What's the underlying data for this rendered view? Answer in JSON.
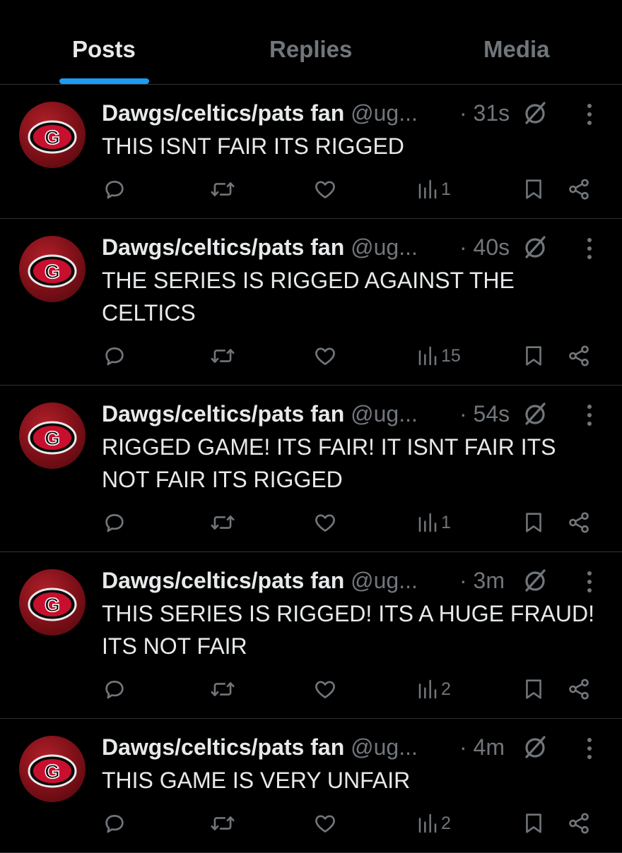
{
  "tabs": [
    {
      "label": "Posts",
      "active": true
    },
    {
      "label": "Replies",
      "active": false
    },
    {
      "label": "Media",
      "active": false
    }
  ],
  "accent_color": "#1d9bf0",
  "author": {
    "name": "Dawgs/celtics/pats fan",
    "handle": "@ug...",
    "avatar_letter": "G"
  },
  "posts": [
    {
      "time": "· 31s",
      "text": "THIS ISNT FAIR ITS RIGGED",
      "views": "1"
    },
    {
      "time": "· 40s",
      "text": "THE SERIES IS RIGGED AGAINST THE CELTICS",
      "views": "15"
    },
    {
      "time": "· 54s",
      "text": "RIGGED GAME! ITS FAIR! IT ISNT FAIR ITS NOT FAIR ITS RIGGED",
      "views": "1"
    },
    {
      "time": "· 3m",
      "text": "THIS SERIES IS RIGGED! ITS A HUGE FRAUD! ITS NOT FAIR",
      "views": "2"
    },
    {
      "time": "· 4m",
      "text": "THIS GAME IS VERY UNFAIR",
      "views": "2"
    }
  ],
  "icons": [
    "reply-icon",
    "repost-icon",
    "like-icon",
    "views-icon",
    "bookmark-icon",
    "share-icon",
    "more-icon",
    "muted-badge-icon"
  ]
}
